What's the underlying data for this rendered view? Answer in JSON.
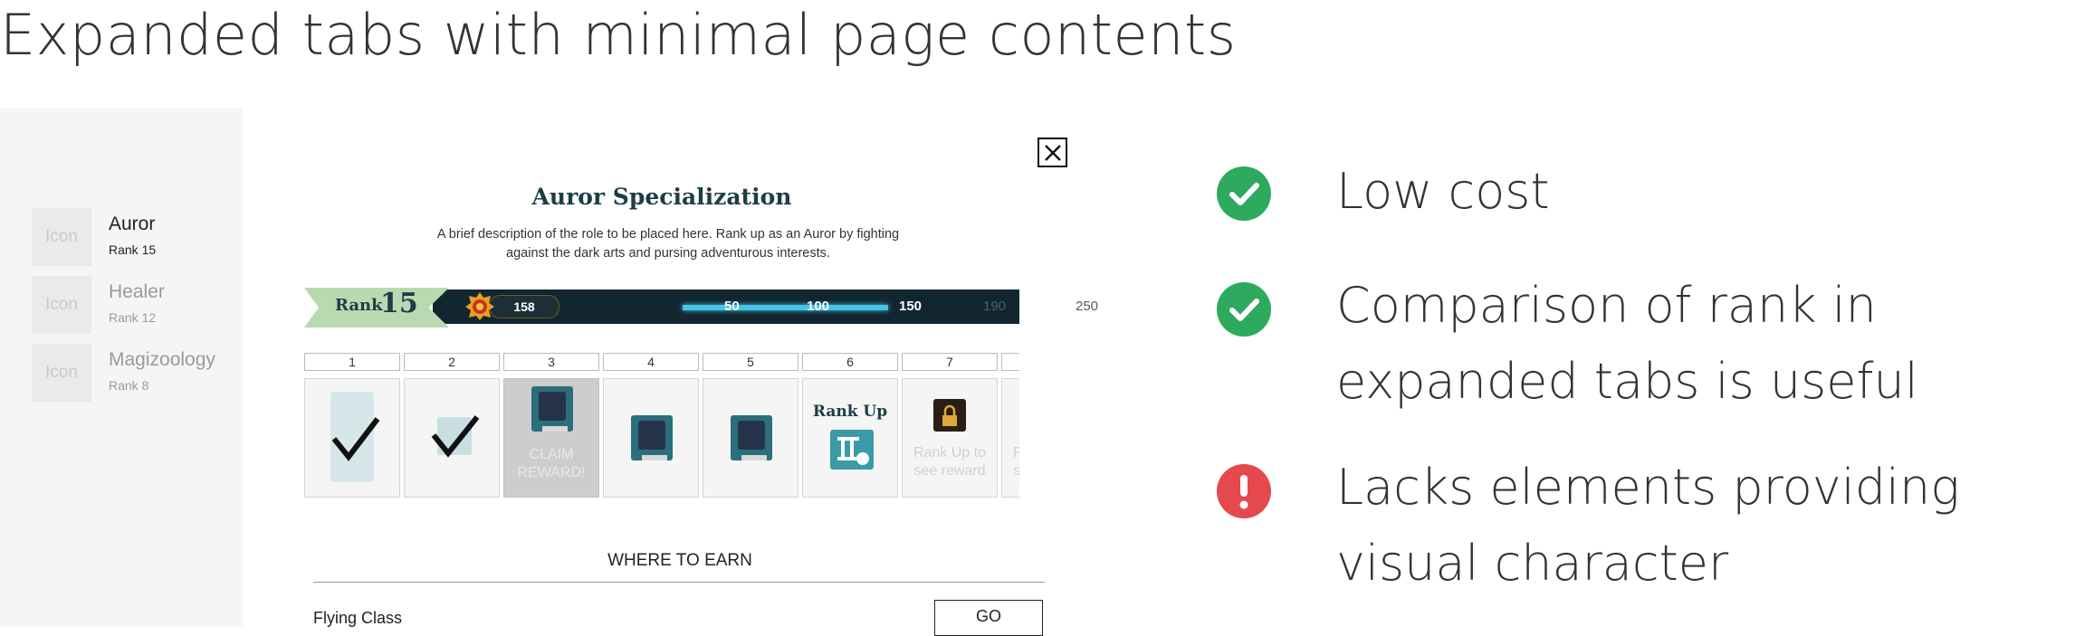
{
  "page_title": "Expanded tabs with minimal page contents",
  "sidebar": {
    "items": [
      {
        "icon_label": "Icon",
        "name": "Auror",
        "rank": "Rank 15",
        "active": true
      },
      {
        "icon_label": "Icon",
        "name": "Healer",
        "rank": "Rank 12",
        "active": false
      },
      {
        "icon_label": "Icon",
        "name": "Magizoology",
        "rank": "Rank 8",
        "active": false
      }
    ]
  },
  "panel": {
    "title": "Auror Specialization",
    "description": "A brief description of the role to be placed here. Rank up as an Auror by fighting against the dark arts and pursing adventurous interests.",
    "rank_label": "Rank",
    "rank_value": "15",
    "xp_value": "158",
    "milestones": [
      "50",
      "100",
      "150",
      "190",
      "250"
    ],
    "progress_fraction": 0.61
  },
  "reward_columns": [
    {
      "num": "1",
      "state": "claimed"
    },
    {
      "num": "2",
      "state": "claimed"
    },
    {
      "num": "3",
      "state": "claim",
      "text": "CLAIM REWARD!"
    },
    {
      "num": "4",
      "state": "reward"
    },
    {
      "num": "5",
      "state": "reward"
    },
    {
      "num": "6",
      "state": "rankup",
      "text": "Rank Up"
    },
    {
      "num": "7",
      "state": "locked",
      "text": "Rank Up to see reward"
    },
    {
      "num": "",
      "state": "locked",
      "text": "Rank Up to see reward"
    }
  ],
  "where_to_earn": {
    "title": "WHERE TO EARN",
    "items": [
      {
        "label": "Flying Class",
        "button": "GO"
      }
    ]
  },
  "feedback": [
    {
      "type": "positive",
      "icon": "check-circle-icon",
      "text": "Low cost",
      "color": "#2daa5e"
    },
    {
      "type": "positive",
      "icon": "check-circle-icon",
      "text": "Comparison of rank in expanded tabs is useful",
      "color": "#2daa5e"
    },
    {
      "type": "negative",
      "icon": "exclamation-circle-icon",
      "text": "Lacks elements providing visual character",
      "color": "#e5484d"
    }
  ],
  "colors": {
    "accent": "#1d3d47",
    "progress": "#46c5e6",
    "ribbon": "#b9d9b0"
  }
}
